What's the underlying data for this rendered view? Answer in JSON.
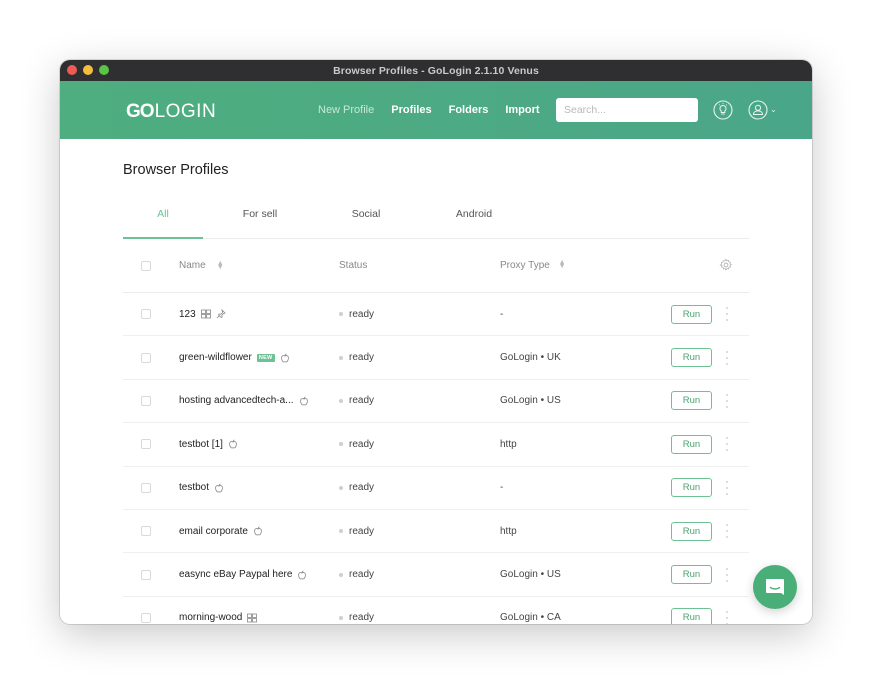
{
  "window": {
    "title": "Browser Profiles - GoLogin 2.1.10 Venus"
  },
  "header": {
    "logo_bold": "GO",
    "logo_light": "LOGIN",
    "nav": [
      {
        "label": "New Profile"
      },
      {
        "label": "Profiles"
      },
      {
        "label": "Folders"
      },
      {
        "label": "Import"
      }
    ],
    "search_placeholder": "Search...",
    "search_value": ""
  },
  "page": {
    "title": "Browser Profiles",
    "tabs": [
      {
        "label": "All",
        "active": true
      },
      {
        "label": "For sell",
        "active": false
      },
      {
        "label": "Social",
        "active": false
      },
      {
        "label": "Android",
        "active": false
      }
    ]
  },
  "table": {
    "columns": {
      "name": "Name",
      "status": "Status",
      "proxy": "Proxy Type"
    },
    "run_label": "Run",
    "new_badge": "NEW",
    "rows": [
      {
        "name": "123",
        "os": "windows",
        "pinned": true,
        "badge": "",
        "status": "ready",
        "proxy": "-"
      },
      {
        "name": "green-wildflower",
        "os": "mac",
        "pinned": false,
        "badge": "NEW",
        "status": "ready",
        "proxy": "GoLogin • UK"
      },
      {
        "name": "hosting advancedtech-a...",
        "os": "mac",
        "pinned": false,
        "badge": "",
        "status": "ready",
        "proxy": "GoLogin • US"
      },
      {
        "name": "testbot [1]",
        "os": "mac",
        "pinned": false,
        "badge": "",
        "status": "ready",
        "proxy": "http"
      },
      {
        "name": "testbot",
        "os": "mac",
        "pinned": false,
        "badge": "",
        "status": "ready",
        "proxy": "-"
      },
      {
        "name": "email corporate",
        "os": "mac",
        "pinned": false,
        "badge": "",
        "status": "ready",
        "proxy": "http"
      },
      {
        "name": "easync eBay Paypal here",
        "os": "mac",
        "pinned": false,
        "badge": "",
        "status": "ready",
        "proxy": "GoLogin • US"
      },
      {
        "name": "morning-wood",
        "os": "windows",
        "pinned": false,
        "badge": "",
        "status": "ready",
        "proxy": "GoLogin • CA"
      }
    ]
  },
  "colors": {
    "accent": "#6cc294",
    "header_bg": "#4fae7f",
    "chat_bg": "#4aae78"
  }
}
